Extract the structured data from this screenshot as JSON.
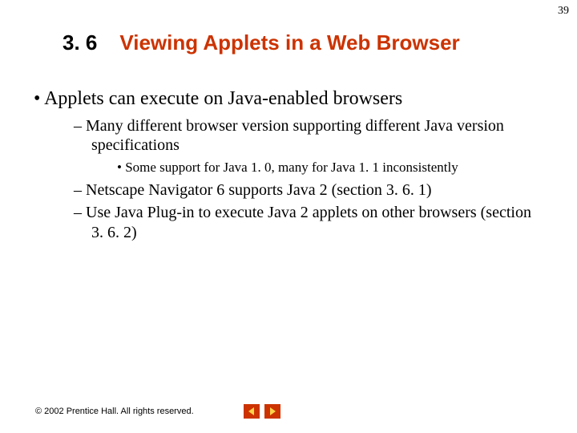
{
  "page_number": "39",
  "header": {
    "section_number": "3. 6",
    "title": "Viewing Applets in a Web Browser"
  },
  "bullets": {
    "l1_0": "Applets can execute on Java-enabled browsers",
    "l2_0": "Many different browser version supporting different Java version specifications",
    "l3_0": "Some support for Java 1. 0, many for Java 1. 1 inconsistently",
    "l2_1": "Netscape Navigator 6 supports Java 2 (section 3. 6. 1)",
    "l2_2": "Use Java Plug-in to execute Java 2 applets on other browsers (section 3. 6. 2)"
  },
  "footer": {
    "copyright": "© 2002 Prentice Hall. All rights reserved."
  },
  "colors": {
    "accent": "#cc3300"
  }
}
